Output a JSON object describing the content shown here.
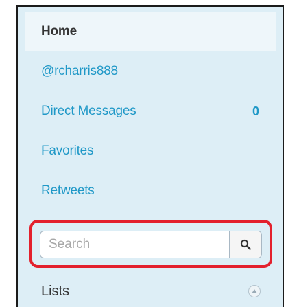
{
  "sidebar": {
    "items": [
      {
        "label": "Home",
        "active": true
      },
      {
        "label": "@rcharris888"
      },
      {
        "label": "Direct Messages",
        "count": "0"
      },
      {
        "label": "Favorites"
      },
      {
        "label": "Retweets"
      }
    ],
    "search": {
      "placeholder": "Search",
      "value": "",
      "button_icon": "search-icon"
    },
    "lists": {
      "label": "Lists",
      "toggle_icon": "chevron-up-icon"
    }
  },
  "colors": {
    "panel_bg": "#ddeef6",
    "link": "#1f98c7",
    "highlight_ring": "#e3212d"
  }
}
